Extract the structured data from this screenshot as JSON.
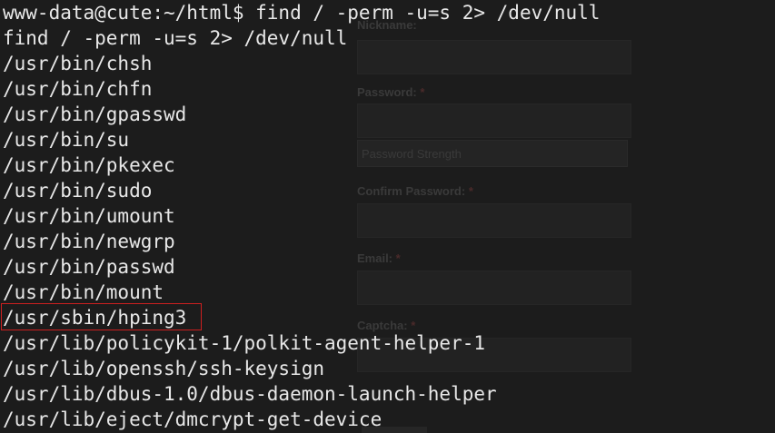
{
  "terminal": {
    "prompt_line": "www-data@cute:~/html$ find / -perm -u=s 2> /dev/null",
    "output_lines": [
      "find / -perm -u=s 2> /dev/null",
      "/usr/bin/chsh",
      "/usr/bin/chfn",
      "/usr/bin/gpasswd",
      "/usr/bin/su",
      "/usr/bin/pkexec",
      "/usr/bin/sudo",
      "/usr/bin/umount",
      "/usr/bin/newgrp",
      "/usr/bin/passwd",
      "/usr/bin/mount",
      "/usr/sbin/hping3",
      "/usr/lib/policykit-1/polkit-agent-helper-1",
      "/usr/lib/openssh/ssh-keysign",
      "/usr/lib/dbus-1.0/dbus-daemon-launch-helper",
      "/usr/lib/eject/dmcrypt-get-device"
    ],
    "highlighted_line": "/usr/sbin/hping3",
    "text_color": "#e8e8e8",
    "background_color": "#1c1c1c",
    "highlight_color": "#cc1f1f"
  },
  "background_form": {
    "nickname_label": "Nickname:",
    "password_label": "Password:",
    "password_strength": "Password Strength",
    "confirm_password_label": "Confirm Password:",
    "email_label": "Email:",
    "captcha_label": "Captcha:",
    "required_mark": "*"
  }
}
